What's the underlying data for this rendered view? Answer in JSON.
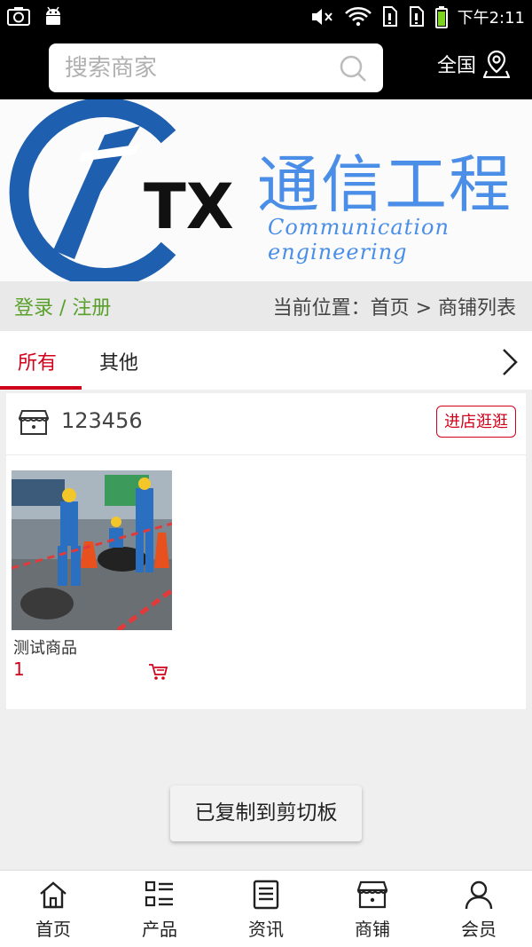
{
  "status_bar": {
    "time": "下午2:11"
  },
  "search": {
    "placeholder": "搜索商家"
  },
  "region": {
    "label": "全国"
  },
  "banner": {
    "logo_text": "TX",
    "title": "通信工程",
    "subtitle": "Communication engineering"
  },
  "crumbbar": {
    "login": "登录 / 注册",
    "location": "当前位置：首页 > 商铺列表"
  },
  "tabs": [
    {
      "label": "所有",
      "active": true
    },
    {
      "label": "其他",
      "active": false
    }
  ],
  "store": {
    "name": "123456",
    "visit_label": "进店逛逛",
    "products": [
      {
        "name": "测试商品",
        "price": "1"
      }
    ]
  },
  "toast": {
    "text": "已复制到剪切板"
  },
  "nav": {
    "items": [
      {
        "label": "首页",
        "icon": "home-icon"
      },
      {
        "label": "产品",
        "icon": "grid-list-icon"
      },
      {
        "label": "资讯",
        "icon": "news-icon"
      },
      {
        "label": "商铺",
        "icon": "shop-icon"
      },
      {
        "label": "会员",
        "icon": "user-icon"
      }
    ]
  },
  "colors": {
    "accent": "#d0021b",
    "link_green": "#5aa02c",
    "brand_blue": "#4a8ee8"
  }
}
